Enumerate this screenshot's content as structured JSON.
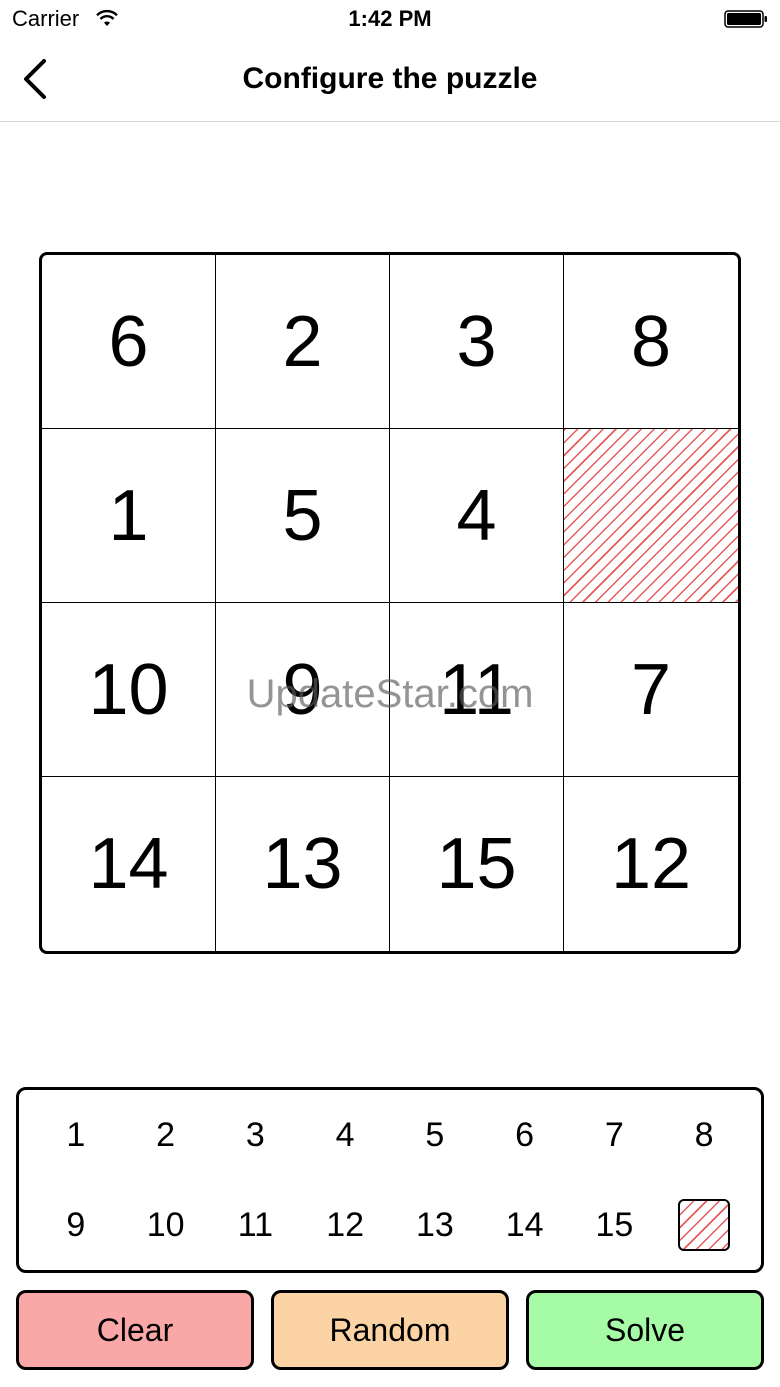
{
  "status_bar": {
    "carrier": "Carrier",
    "time": "1:42 PM"
  },
  "nav": {
    "title": "Configure the puzzle",
    "back_icon": "chevron-left-icon"
  },
  "board": {
    "tiles": [
      "6",
      "2",
      "3",
      "8",
      "1",
      "5",
      "4",
      "",
      "10",
      "9",
      "11",
      "7",
      "14",
      "13",
      "15",
      "12"
    ],
    "blank_index": 7,
    "blank_color": "#e85a5a"
  },
  "watermark": "UpdateStar.com",
  "palette": {
    "items": [
      "1",
      "2",
      "3",
      "4",
      "5",
      "6",
      "7",
      "8",
      "9",
      "10",
      "11",
      "12",
      "13",
      "14",
      "15",
      ""
    ],
    "blank_index": 15
  },
  "buttons": {
    "clear": {
      "label": "Clear",
      "color": "#f9a7a7"
    },
    "random": {
      "label": "Random",
      "color": "#fcd3a4"
    },
    "solve": {
      "label": "Solve",
      "color": "#a6fba6"
    }
  }
}
